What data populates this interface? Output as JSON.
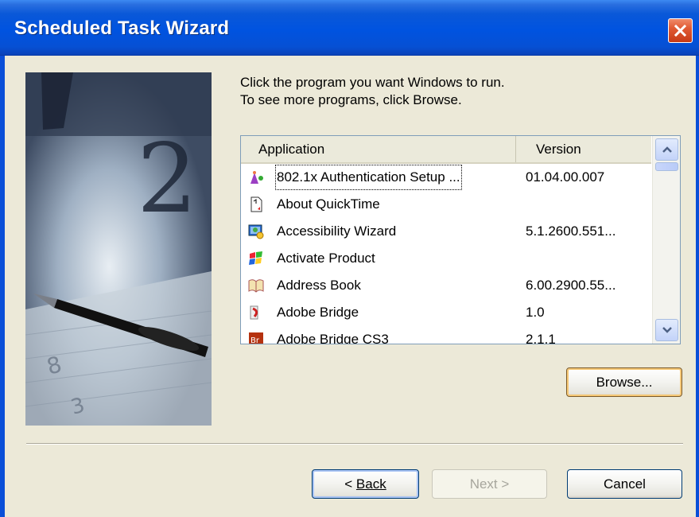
{
  "window": {
    "title": "Scheduled Task Wizard",
    "close_icon": "close-icon"
  },
  "instructions": {
    "line1": "Click the program you want Windows to run.",
    "line2": "To see more programs, click Browse."
  },
  "list": {
    "columns": {
      "application": "Application",
      "version": "Version"
    },
    "rows": [
      {
        "name": "802.1x Authentication Setup ...",
        "version": "01.04.00.007",
        "icon": "wizard-icon"
      },
      {
        "name": "About QuickTime",
        "version": "",
        "icon": "quicktime-doc-icon"
      },
      {
        "name": "Accessibility Wizard",
        "version": "5.1.2600.551...",
        "icon": "accessibility-icon"
      },
      {
        "name": "Activate Product",
        "version": "",
        "icon": "windows-flag-icon"
      },
      {
        "name": "Address Book",
        "version": "6.00.2900.55...",
        "icon": "address-book-icon"
      },
      {
        "name": "Adobe Bridge",
        "version": "1.0",
        "icon": "adobe-bridge-icon"
      },
      {
        "name": "Adobe Bridge CS3",
        "version": "2.1.1",
        "icon": "adobe-bridge-cs3-icon"
      }
    ]
  },
  "buttons": {
    "browse": "Browse...",
    "back": "Back",
    "next": "Next >",
    "cancel": "Cancel"
  },
  "colors": {
    "titlebar": "#0053e0",
    "dialog_bg": "#ece9d8",
    "focus_ring": "#f7c977"
  }
}
